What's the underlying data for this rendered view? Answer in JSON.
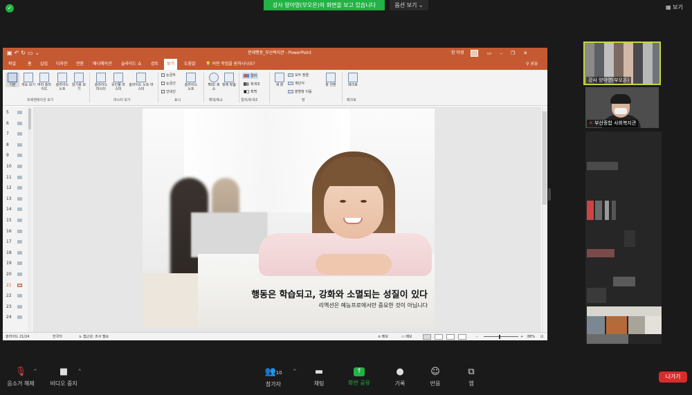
{
  "zoom": {
    "share_banner": "강사 양아영(부오온)의 화면을 보고 있습니다",
    "view_options": "옵션 보기 ⌄",
    "view_button": "보기"
  },
  "ppt": {
    "doc_title": "문제행동_부산복지관 - PowerPoint",
    "user_name": "양 아영",
    "tell_me": "어떤 작업을 원하시나요?",
    "share": "공유",
    "tabs": [
      "파일",
      "홈",
      "삽입",
      "디자인",
      "전환",
      "애니메이션",
      "슬라이드 쇼",
      "검토",
      "보기",
      "도움말"
    ],
    "active_tab": "보기",
    "ribbon": {
      "buttons": [
        "기본",
        "개요 보기",
        "여러 슬라이드",
        "슬라이드 노트",
        "읽기용 보기",
        "슬라이드 마스터",
        "유인물 마스터",
        "슬라이드 노트 마스터",
        "슬라이드 노트",
        "확대/ 축소",
        "창에 맞춤",
        "새 창"
      ],
      "checkboxes": [
        "눈금자",
        "눈금선",
        "안내선"
      ],
      "color_options": [
        "컬러",
        "회색조",
        "흑백"
      ],
      "window_items": [
        "모두 정렬",
        "계단식",
        "분할창 이동"
      ],
      "switch_window": "창 전환",
      "macro": "매크로",
      "groups": [
        "프레젠테이션 보기",
        "마스터 보기",
        "표시",
        "확대/축소",
        "컬러/회색조",
        "창",
        "매크로"
      ]
    },
    "thumbnails": [
      "5",
      "6",
      "7",
      "8",
      "9",
      "10",
      "11",
      "12",
      "13",
      "14",
      "15",
      "16",
      "17",
      "18",
      "19",
      "20",
      "21",
      "22",
      "23",
      "24"
    ],
    "selected_slide": "21",
    "slide": {
      "title": "행동은 학습되고, 강화와 소멸되는 성질이 있다",
      "subtitle": "리액션은 예능프로에서만 중요한 것이 아닙니다"
    },
    "status": {
      "slide_count": "슬라이드 21/24",
      "language": "한국어",
      "accessibility": "접근성: 조사 필요",
      "notes": "메모",
      "comments": "메모",
      "zoom": "88%"
    }
  },
  "participants": {
    "presenter": "강사 양아영(부오온)",
    "center": "부산종합 사회복지관"
  },
  "toolbar": {
    "mute": "음소거 해제",
    "video": "비디오 중지",
    "participants": "참가자",
    "participants_count": "10",
    "chat": "채팅",
    "share": "화면 공유",
    "record": "기록",
    "reactions": "반응",
    "apps": "앱",
    "leave": "나가기"
  },
  "colors": {
    "zoom_green": "#23b245",
    "ppt_orange": "#c55a32",
    "leave_red": "#d82c2c",
    "presenter_border": "#c7d83a"
  }
}
